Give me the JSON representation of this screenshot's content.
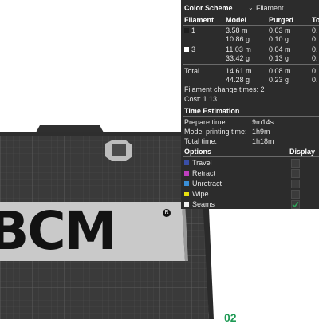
{
  "legend": {
    "color_scheme_label": "Color Scheme",
    "color_scheme_value": "Filament",
    "columns": [
      "Filament",
      "Model",
      "Purged",
      "To"
    ],
    "filaments": [
      {
        "id": "1",
        "swatch": "#2a2a2a",
        "model": [
          "3.58 m",
          "10.86 g"
        ],
        "purged": [
          "0.03 m",
          "0.10 g"
        ],
        "total": [
          "0.",
          "0."
        ]
      },
      {
        "id": "3",
        "swatch": "#ffffff",
        "model": [
          "11.03 m",
          "33.42 g"
        ],
        "purged": [
          "0.04 m",
          "0.13 g"
        ],
        "total": [
          "0.",
          "0."
        ]
      }
    ],
    "total": {
      "label": "Total",
      "model": [
        "14.61 m",
        "44.28 g"
      ],
      "purged": [
        "0.08 m",
        "0.23 g"
      ],
      "total": [
        "0.",
        "0."
      ]
    },
    "change_times": "Filament change times:  2",
    "cost": "Cost:  1.13",
    "time_estimation": {
      "title": "Time Estimation",
      "rows": [
        {
          "label": "Prepare time:",
          "value": "9m14s"
        },
        {
          "label": "Model printing time:",
          "value": "1h9m"
        },
        {
          "label": "Total time:",
          "value": "1h18m"
        }
      ]
    },
    "options": {
      "title": "Options",
      "display_label": "Display",
      "items": [
        {
          "label": "Travel",
          "color": "#3a4fa8",
          "checked": false
        },
        {
          "label": "Retract",
          "color": "#c03fc0",
          "checked": false
        },
        {
          "label": "Unretract",
          "color": "#3a8fd8",
          "checked": false
        },
        {
          "label": "Wipe",
          "color": "#e8e010",
          "checked": false
        },
        {
          "label": "Seams",
          "color": "#f0f0f0",
          "checked": true
        }
      ]
    }
  },
  "plate": {
    "model_text": "BCM",
    "badge": "R",
    "corner_number": "02"
  },
  "colors": {
    "panel_bg": "#2c2c2c",
    "plate_grid": "#3d3d3d",
    "model_fill": "#c9c9c9"
  }
}
